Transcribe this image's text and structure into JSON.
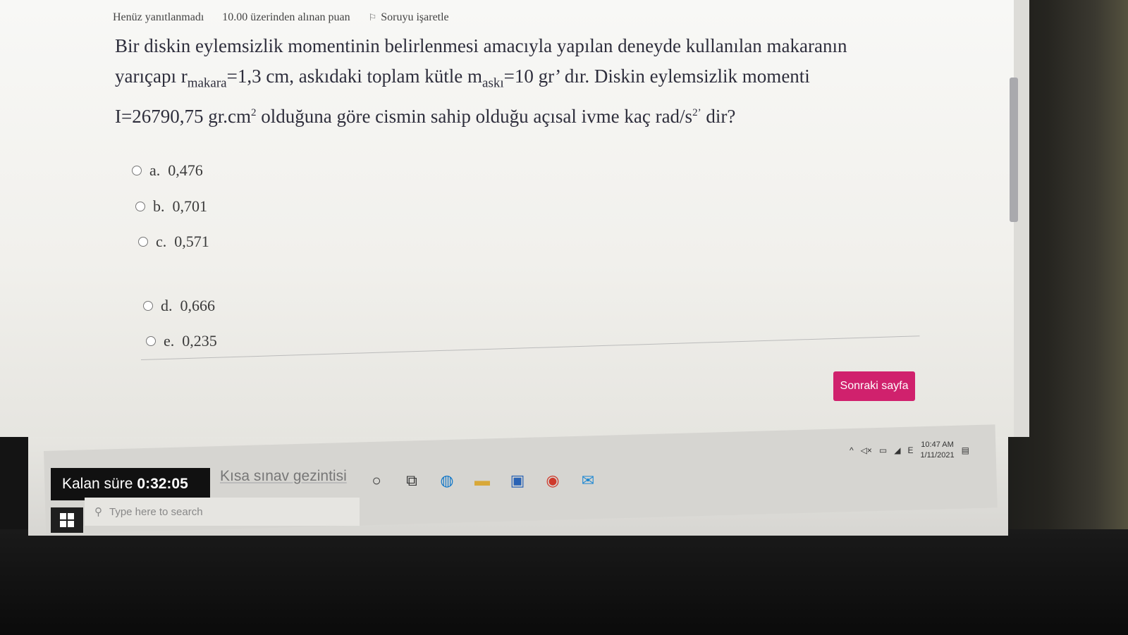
{
  "question_info": {
    "status": "Henüz yanıtlanmadı",
    "score": "10.00 üzerinden alınan puan",
    "flag_label": "Soruyu işaretle",
    "flag_icon": "flag-icon"
  },
  "question": {
    "line1": "Bir diskin eylemsizlik momentinin belirlenmesi amacıyla yapılan deneyde kullanılan makaranın",
    "line2_a": "yarıçapı r",
    "line2_sub1": "makara",
    "line2_b": "=1,3 cm, askıdaki toplam kütle m",
    "line2_sub2": "askı",
    "line2_c": "=10 gr’ dır. Diskin eylemsizlik momenti",
    "line3_a": "I=26790,75 gr.cm",
    "line3_sup1": "2",
    "line3_b": " olduğuna göre cismin sahip olduğu açısal ivme kaç rad/s",
    "line3_sup2": "2’",
    "line3_c": " dir?"
  },
  "options": [
    {
      "letter": "a.",
      "value": "0,476"
    },
    {
      "letter": "b.",
      "value": "0,701"
    },
    {
      "letter": "c.",
      "value": "0,571"
    },
    {
      "letter": "d.",
      "value": "0,666"
    },
    {
      "letter": "e.",
      "value": "0,235"
    }
  ],
  "next_button": {
    "label": "Sonraki sayfa",
    "color": "#d0216d"
  },
  "timer": {
    "label": "Kalan süre",
    "value": "0:32:05"
  },
  "quiz_nav": {
    "label": "Kısa sınav gezintisi"
  },
  "taskbar": {
    "search_placeholder": "Type here to search",
    "time": "10:47 AM",
    "date": "1/11/2021",
    "icons": [
      "windows-start-icon",
      "cortana-icon",
      "task-view-icon",
      "edge-icon",
      "file-explorer-icon",
      "store-icon",
      "chrome-icon",
      "mail-icon"
    ],
    "tray_icons": [
      "chevron-up-icon",
      "volume-muted-icon",
      "network-icon",
      "wifi-icon",
      "language-icon",
      "notification-icon"
    ]
  }
}
